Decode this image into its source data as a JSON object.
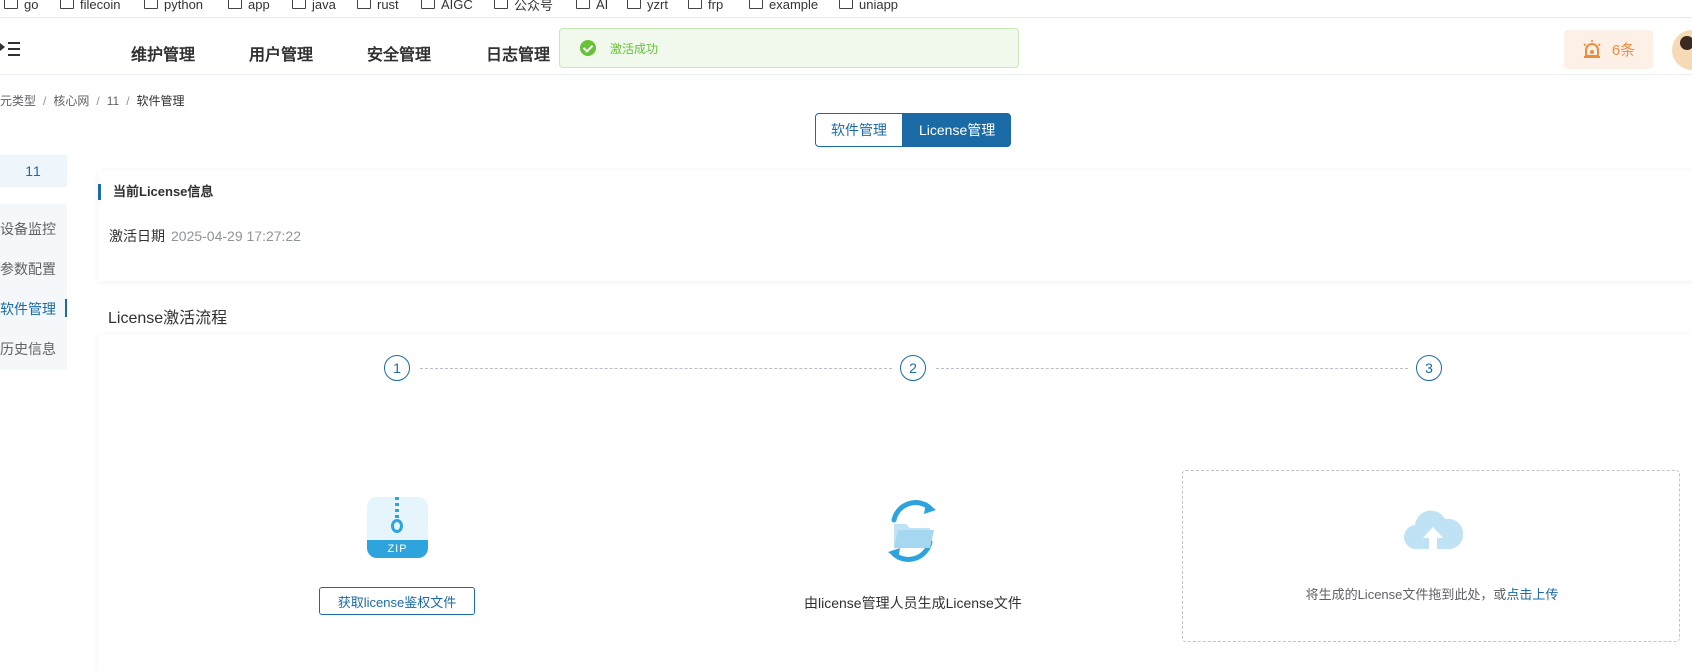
{
  "bookmarks": [
    "go",
    "filecoin",
    "python",
    "app",
    "java",
    "rust",
    "AIGC",
    "公众号",
    "AI",
    "yzrt",
    "frp",
    "example",
    "uniapp"
  ],
  "nav": {
    "items": [
      "维护管理",
      "用户管理",
      "安全管理",
      "日志管理"
    ],
    "toast": "激活成功",
    "alert_count": "6条"
  },
  "breadcrumb": [
    "网元类型",
    "核心网",
    "11",
    "软件管理"
  ],
  "tabs": {
    "software": "软件管理",
    "license": "License管理"
  },
  "sidebar": {
    "top": "11",
    "items": [
      "设备监控",
      "参数配置",
      "软件管理",
      "历史信息"
    ]
  },
  "license_info": {
    "title": "当前License信息",
    "activation_label": "激活日期",
    "activation_date": "2025-04-29 17:27:22"
  },
  "flow": {
    "title": "License激活流程",
    "steps": [
      "1",
      "2",
      "3"
    ],
    "zip_label": "ZIP",
    "get_file_button": "获取license鉴权文件",
    "step2_text": "由license管理人员生成License文件",
    "upload_text": "将生成的License文件拖到此处，或",
    "upload_link": "点击上传"
  },
  "colors": {
    "primary": "#1a6aa6",
    "success": "#67c23a",
    "warning": "#f18a3d",
    "upload_icon": "#bfe3f5",
    "zip_icon": "#2ea4de"
  }
}
